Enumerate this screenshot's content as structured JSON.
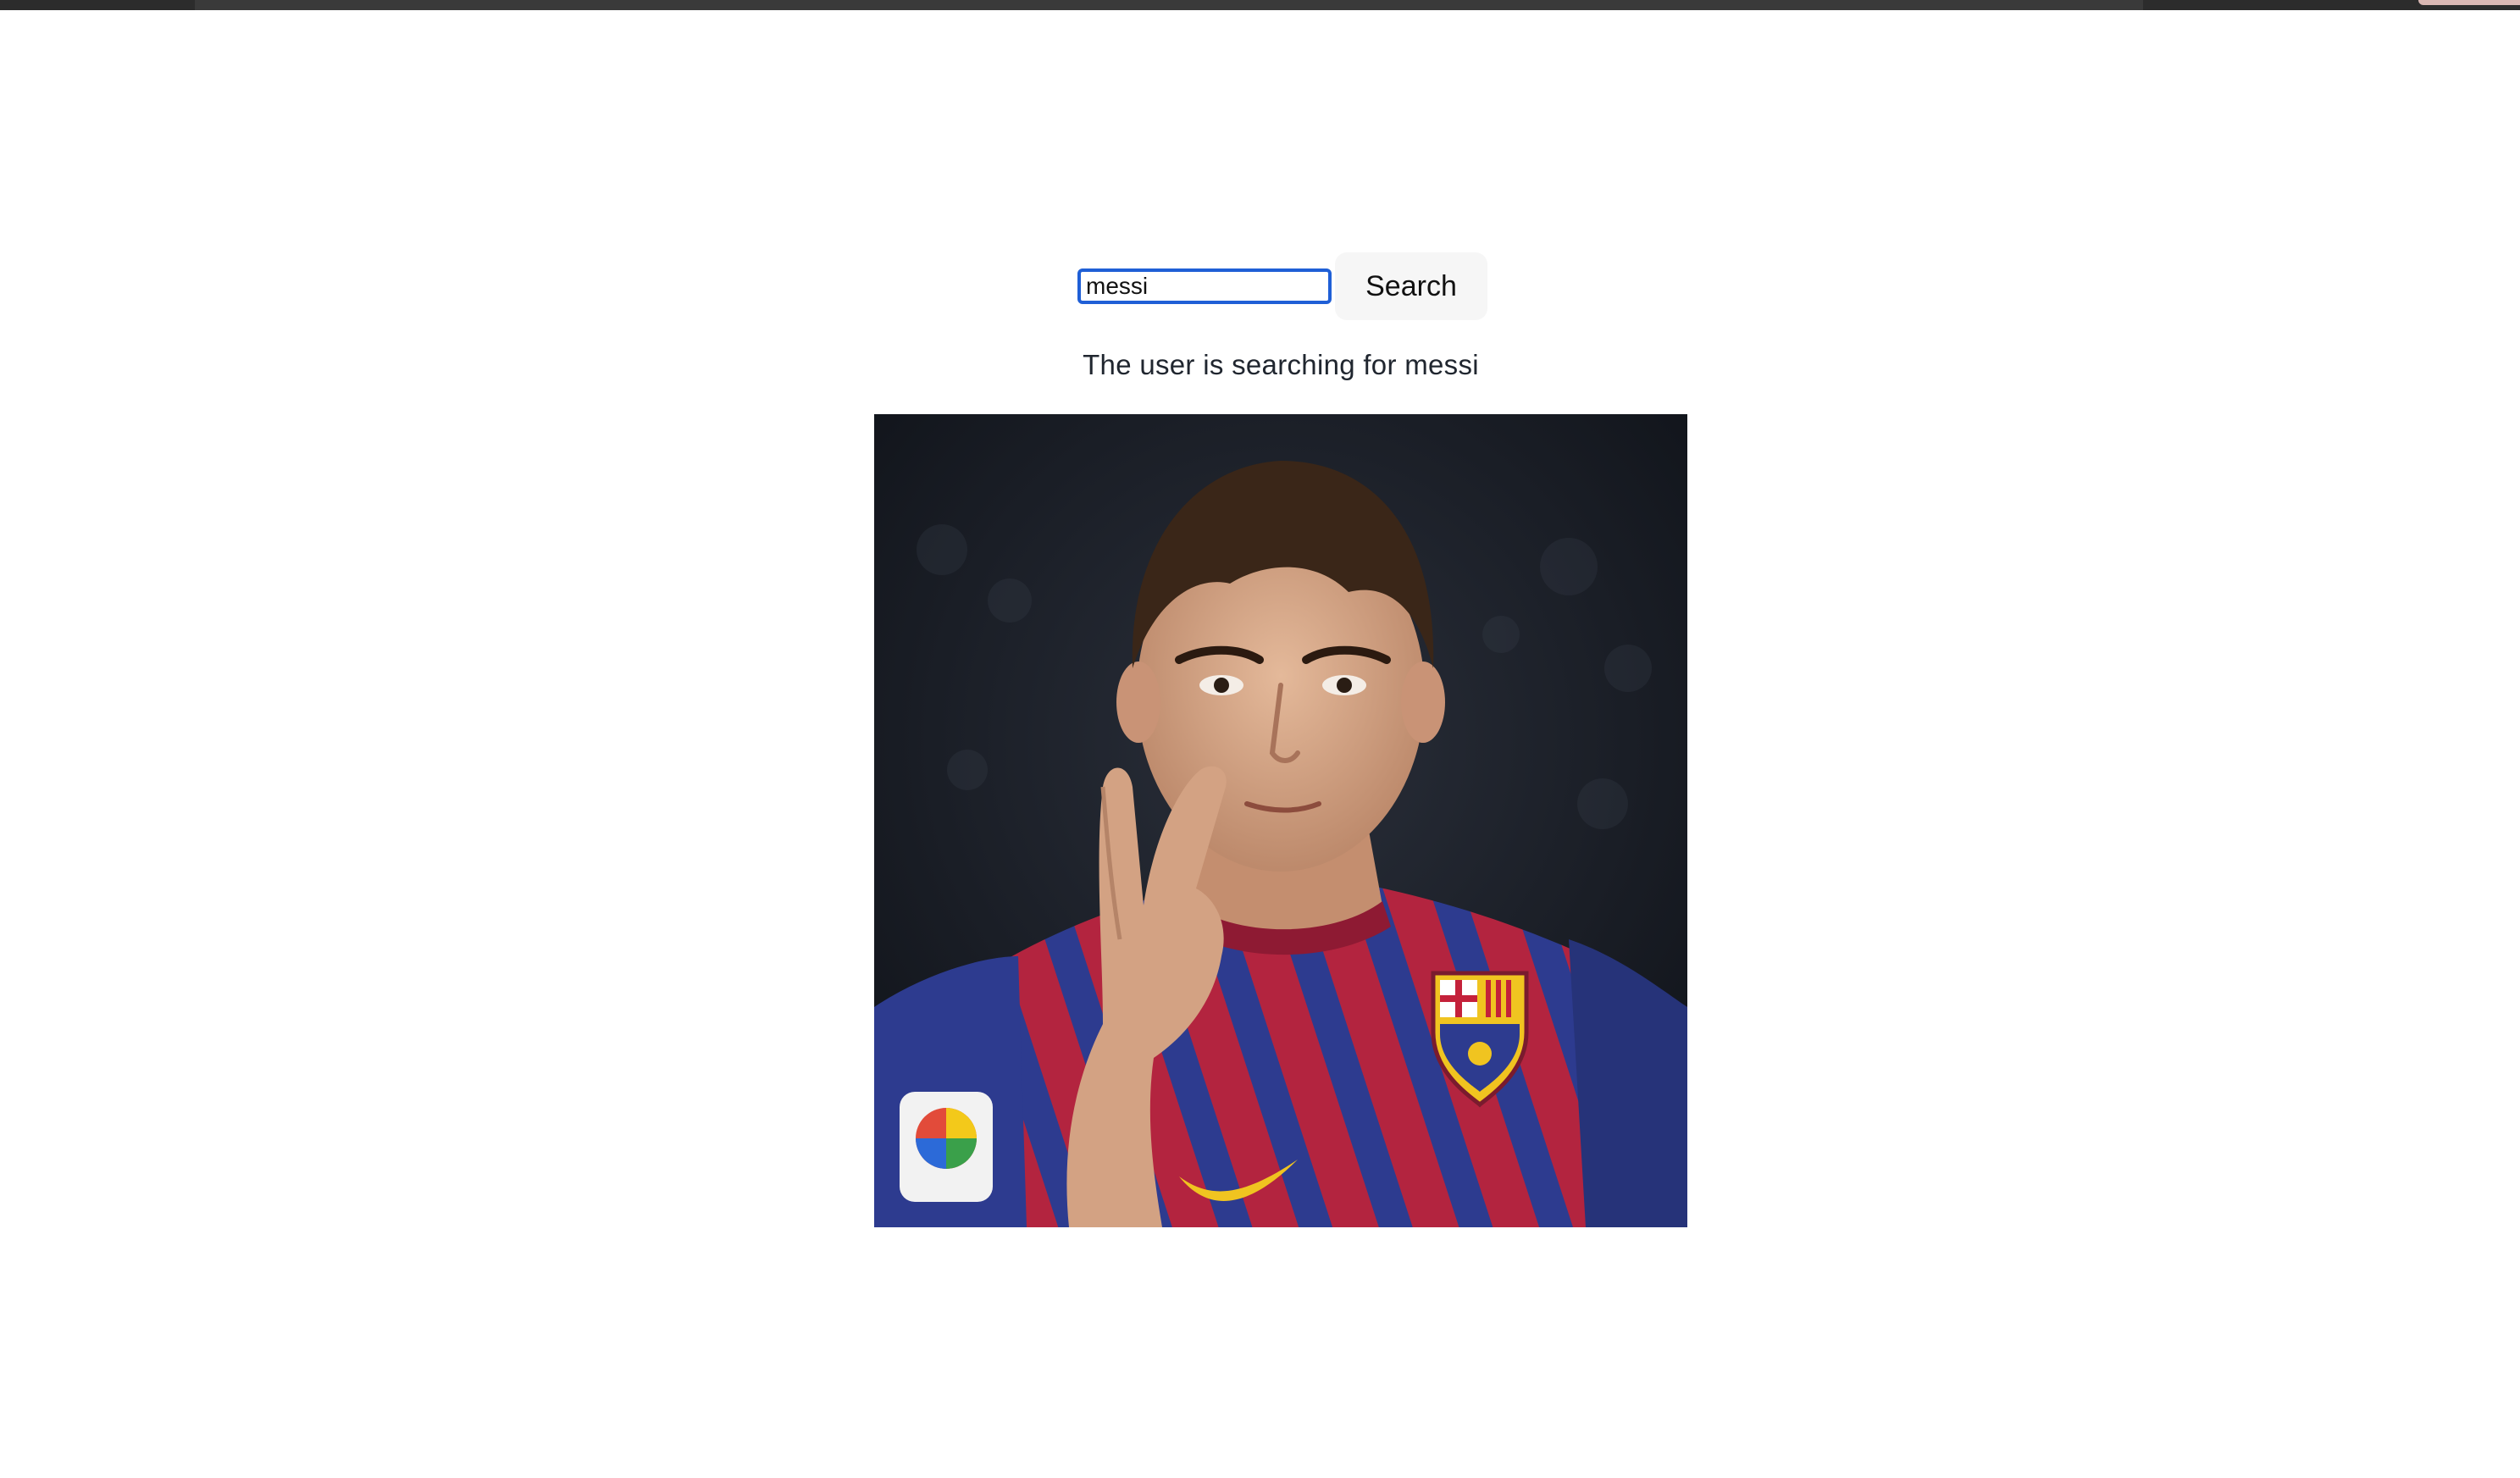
{
  "search": {
    "query": "messi",
    "button_label": "Search"
  },
  "status": {
    "text": "The user is searching for messi"
  },
  "result": {
    "image_description_icon": "photo-of-soccer-player",
    "colors": {
      "background": "#15181f",
      "jersey_red": "#b3243f",
      "jersey_blue": "#2d3b8f",
      "skin": "#d7a989",
      "hair": "#3a2618",
      "logo_yellow": "#f0c420"
    }
  }
}
